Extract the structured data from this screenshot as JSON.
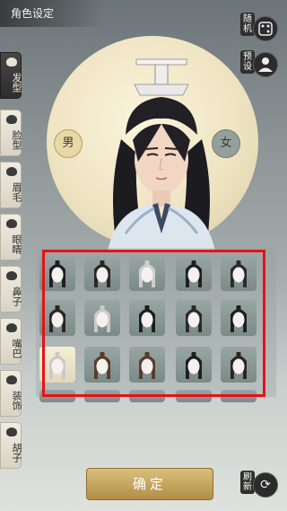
{
  "header": {
    "title": "角色设定"
  },
  "gender": {
    "male": "男",
    "female": "女"
  },
  "right_buttons": {
    "random": "随机",
    "preset": "预设",
    "refresh": "刷新"
  },
  "sidebar": {
    "items": [
      {
        "label": "发型",
        "active": true
      },
      {
        "label": "脸型",
        "active": false
      },
      {
        "label": "眉毛",
        "active": false
      },
      {
        "label": "眼睛",
        "active": false
      },
      {
        "label": "鼻子",
        "active": false
      },
      {
        "label": "嘴巴",
        "active": false
      },
      {
        "label": "装饰",
        "active": false
      },
      {
        "label": "胡子",
        "active": false
      }
    ]
  },
  "confirm": {
    "label": "确定"
  },
  "colors": {
    "highlight": "#e51218",
    "gold": "#c9a862",
    "dark": "#2e2e2e"
  },
  "icons": [
    "dice-icon",
    "preset-icon",
    "refresh-icon"
  ]
}
